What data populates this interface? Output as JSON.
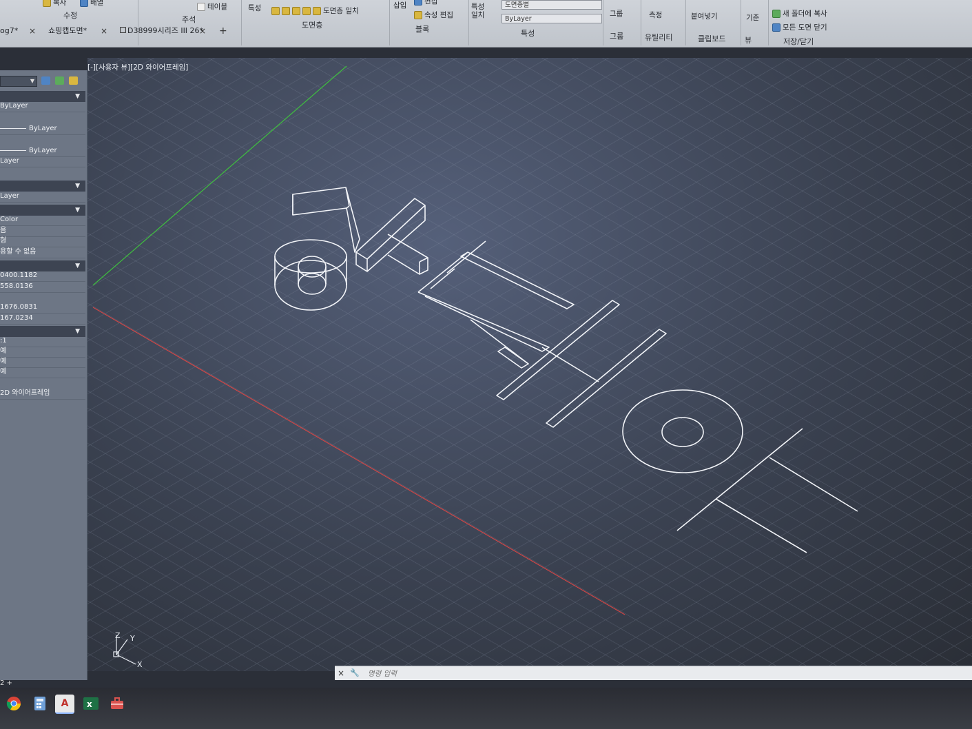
{
  "ribbon": {
    "groups": [
      {
        "title": "수정",
        "items": [
          "복사",
          "배열"
        ]
      },
      {
        "title": "주석",
        "items": [
          "테이블"
        ]
      },
      {
        "title": "도면층",
        "items": [
          "특성",
          "도면층 일치"
        ]
      },
      {
        "title": "블록",
        "items": [
          "삽입",
          "편집",
          "속성 편집"
        ]
      },
      {
        "title": "특성",
        "items": [
          "특성 일치",
          "도면층별",
          "ByLayer"
        ]
      },
      {
        "title": "그룹",
        "items": [
          "그룹"
        ]
      },
      {
        "title": "유틸리티",
        "items": [
          "측정"
        ]
      },
      {
        "title": "클립보드",
        "items": [
          "붙여넣기"
        ]
      },
      {
        "title": "뷰",
        "items": [
          "기준"
        ]
      },
      {
        "title": "저장/닫기",
        "items": [
          "새 폴더에 복사",
          "모든 도면 닫기"
        ]
      }
    ]
  },
  "tabs": [
    {
      "label": "og7*"
    },
    {
      "label": "쇼핑캡도면*"
    },
    {
      "label": "D38999시리즈 III 26*"
    }
  ],
  "tab_add": "+",
  "tab_close": "×",
  "palette": {
    "rows": [
      {
        "text": "ByLayer"
      },
      {
        "text": "ByLayer"
      },
      {
        "text": "ByLayer"
      },
      {
        "text": "Layer"
      },
      {
        "text": "Layer"
      },
      {
        "text": "Color"
      },
      {
        "text": "음"
      },
      {
        "text": "형"
      },
      {
        "text": "용할 수 없음"
      },
      {
        "text": "0400.1182"
      },
      {
        "text": "558.0136"
      },
      {
        "text": "1676.0831"
      },
      {
        "text": "167.0234"
      },
      {
        "text": ":1"
      },
      {
        "text": "예"
      },
      {
        "text": "예"
      },
      {
        "text": "예"
      },
      {
        "text": "2D 와이어프레임"
      }
    ]
  },
  "viewport": {
    "label": "[-][사용자 뷰][2D 와이어프레임]",
    "ucs": {
      "z": "Z",
      "y": "Y",
      "x": "X"
    }
  },
  "command": {
    "placeholder": "명령 입력",
    "close": "×",
    "customize": "🔧"
  },
  "layout_tabs": "2  +",
  "colors": {
    "x_axis": "#d04545",
    "y_axis": "#3fbf3f",
    "wire": "#f2f4f8",
    "accent": "#4f84c4"
  },
  "taskbar": {
    "apps": [
      "chrome-icon",
      "calculator-icon",
      "autocad-icon",
      "excel-icon",
      "toolbox-icon"
    ]
  }
}
